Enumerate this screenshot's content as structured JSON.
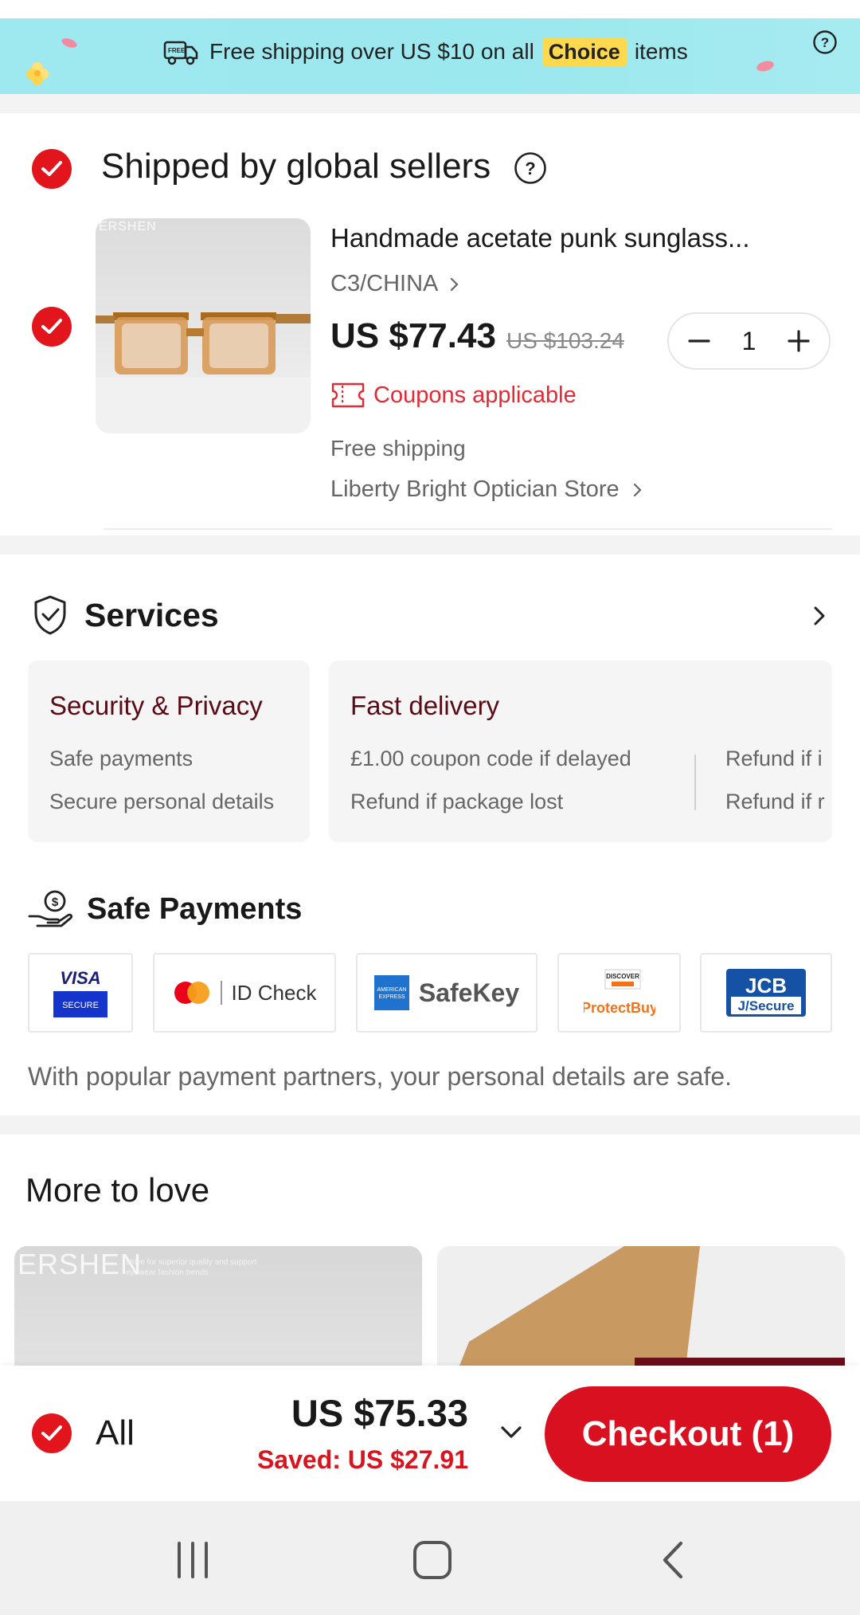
{
  "banner": {
    "text_before": "Free shipping over US $10 on all",
    "choice_label": "Choice",
    "text_after": "items"
  },
  "seller_group": {
    "title": "Shipped by global sellers"
  },
  "cart_item": {
    "thumbnail_brand": "ERSHEN",
    "title": "Handmade acetate punk sunglass...",
    "variant": "C3/CHINA",
    "price": "US $77.43",
    "original_price": "US $103.24",
    "quantity": "1",
    "coupon_text": "Coupons applicable",
    "shipping": "Free shipping",
    "store": "Liberty Bright Optician Store"
  },
  "services": {
    "title": "Services",
    "security": {
      "title": "Security & Privacy",
      "lines": [
        "Safe payments",
        "Secure personal details"
      ]
    },
    "delivery": {
      "title": "Fast delivery",
      "lines": [
        "£1.00 coupon code if delayed",
        "Refund if package lost"
      ],
      "extra_lines": [
        "Refund if i",
        "Refund if r"
      ]
    }
  },
  "payments": {
    "title": "Safe Payments",
    "logos": {
      "visa": "VISA",
      "visa_sub": "SECURE",
      "mastercard": "ID Check",
      "amex_box": "AMERICAN EXPRESS",
      "amex": "SafeKey",
      "discover": "DISCOVER",
      "discover_sub": "ProtectBuy",
      "jcb": "JCB",
      "jcb_sub": "J/Secure"
    },
    "note": "With popular payment partners, your personal details are safe."
  },
  "more_to_love": {
    "title": "More to love",
    "rec1_brand": "ERSHEN",
    "rec1_tagline": "strive for superior quality and support eyewear fashion trends"
  },
  "bottom_bar": {
    "all_label": "All",
    "total": "US $75.33",
    "saved": "Saved: US $27.91",
    "checkout": "Checkout (1)"
  },
  "colors": {
    "brand_red": "#d9101f",
    "banner_cyan": "#9ee9ef",
    "choice_yellow": "#ffd94d"
  }
}
